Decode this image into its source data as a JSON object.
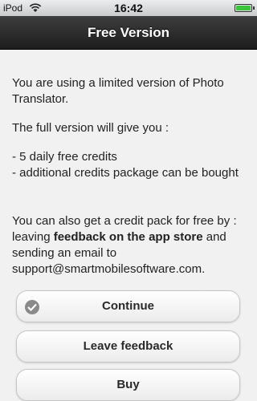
{
  "status_bar": {
    "carrier": "iPod",
    "time": "16:42",
    "wifi_icon": "wifi-icon",
    "battery_icon": "battery-icon",
    "battery_level_percent": 100
  },
  "nav": {
    "title": "Free Version"
  },
  "content": {
    "p1": "You are using a limited version of Photo Translator.",
    "p2": "The full version will give you :",
    "bullet1": "- 5 daily free credits",
    "bullet2": "- additional credits package can be bought",
    "p3_prefix": "You can also get a credit pack for free by : leaving ",
    "p3_bold": "feedback on the app store",
    "p3_suffix": " and sending an email to support@smartmobilesoftware.com."
  },
  "buttons": {
    "continue": "Continue",
    "feedback": "Leave feedback",
    "buy": "Buy"
  },
  "colors": {
    "nav_bg": "#1d1d1d",
    "page_bg": "#f1f1f1",
    "battery": "#3cc43c"
  }
}
